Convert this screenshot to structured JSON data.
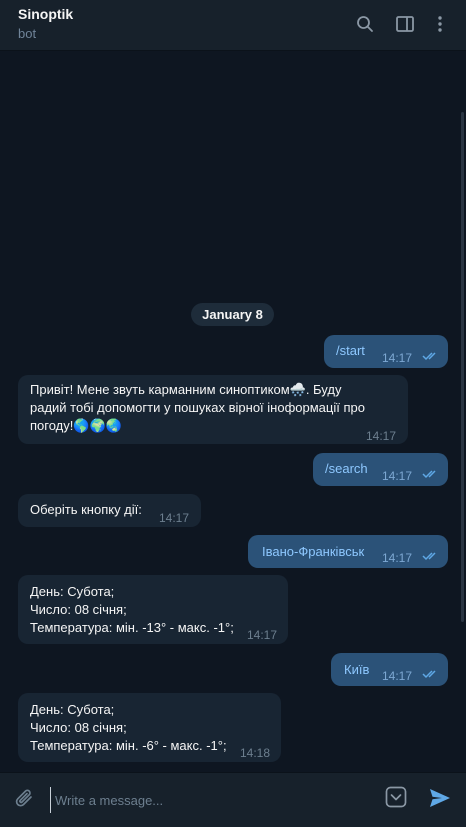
{
  "header": {
    "title": "Sinoptik",
    "subtitle": "bot"
  },
  "chat": {
    "date_label": "January 8",
    "messages": [
      {
        "direction": "out",
        "text": "/start",
        "time": "14:17"
      },
      {
        "direction": "in",
        "text": "Привіт! Мене звуть карманним синоптиком🌨️. Буду\nрадий тобі допомогти у пошуках вірної іноформації про\nпогоду!🌎🌍🌏",
        "time": "14:17"
      },
      {
        "direction": "out",
        "text": "/search",
        "time": "14:17"
      },
      {
        "direction": "in",
        "text": "Оберіть кнопку дії:",
        "time": "14:17"
      },
      {
        "direction": "out",
        "text": "Івано-Франківськ",
        "time": "14:17"
      },
      {
        "direction": "in",
        "text": "День: Субота;\nЧисло: 08 січня;\nТемпература: мін. -13° - макс. -1°;",
        "time": "14:17"
      },
      {
        "direction": "out",
        "text": "Київ",
        "time": "14:17"
      },
      {
        "direction": "in",
        "text": "День: Субота;\nЧисло: 08 січня;\nТемпература: мін. -6° - макс. -1°;",
        "time": "14:18"
      }
    ]
  },
  "composer": {
    "placeholder": "Write a message..."
  },
  "icons": {
    "search": "search-icon",
    "sidebar": "sidebar-toggle-icon",
    "menu": "more-vertical-icon",
    "attach": "paperclip-icon",
    "commands": "bot-commands-icon",
    "send": "send-icon",
    "read": "double-check-icon"
  },
  "colors": {
    "background": "#0e1621",
    "header": "#17212b",
    "incoming_bubble": "#182533",
    "outgoing_bubble": "#2b5278",
    "accent": "#5fa8e6"
  }
}
